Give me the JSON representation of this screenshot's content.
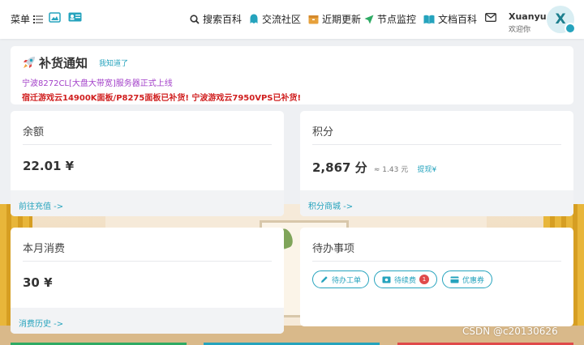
{
  "header": {
    "menu_label": "菜单",
    "nav": [
      {
        "label": "搜索百科"
      },
      {
        "label": "交流社区"
      },
      {
        "label": "近期更新"
      },
      {
        "label": "节点监控"
      },
      {
        "label": "文档百科"
      }
    ],
    "user": {
      "name": "Xuanyu",
      "greeting": "欢迎你",
      "avatar_letter": "X"
    }
  },
  "notice": {
    "title": "补货通知",
    "ack_label": "我知道了",
    "line1": "宁波8272CL[大盘大带宽]服务器正式上线",
    "line2": "宿迁游戏云14900K面板/P8275面板已补货! 宁波游戏云7950VPS已补货!"
  },
  "cards": {
    "balance": {
      "title": "余额",
      "value": "22.01 ¥",
      "footer": "前往充值 ->"
    },
    "points": {
      "title": "积分",
      "value": "2,867 分",
      "sub": "≈ 1.43 元",
      "link": "提现¥",
      "footer": "积分商城 ->"
    },
    "monthly": {
      "title": "本月消费",
      "value": "30 ¥",
      "footer": "消费历史 ->"
    },
    "todo": {
      "title": "待办事项",
      "buttons": [
        {
          "label": "待办工单"
        },
        {
          "label": "待续费",
          "count": "1"
        },
        {
          "label": "优惠券"
        }
      ]
    }
  },
  "watermark": "CSDN @c20130626",
  "colors": {
    "accent": "#25a3bd",
    "notice_purple": "#a340c9",
    "notice_red": "#d01f1f",
    "badge_red": "#e04a4a"
  }
}
